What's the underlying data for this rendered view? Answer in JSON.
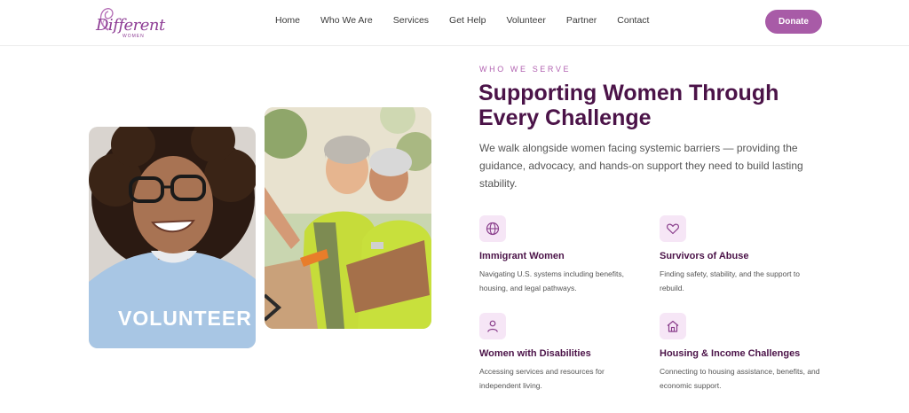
{
  "brand": {
    "logo_word": "Different",
    "logo_sub": "WOMEN"
  },
  "nav": {
    "items": [
      "Home",
      "Who We Are",
      "Services",
      "Get Help",
      "Volunteer",
      "Partner",
      "Contact"
    ],
    "donate_label": "Donate"
  },
  "photos": {
    "volunteer_shirt_text": "VOLUNTEER"
  },
  "section": {
    "eyebrow": "WHO WE SERVE",
    "title": "Supporting Women Through Every Challenge",
    "intro": "We walk alongside women facing systemic barriers — providing the guidance, advocacy, and hands-on support they need to build lasting stability."
  },
  "cards": [
    {
      "icon": "globe-icon",
      "title": "Immigrant Women",
      "desc": "Navigating U.S. systems including benefits, housing, and legal pathways."
    },
    {
      "icon": "heart-icon",
      "title": "Survivors of Abuse",
      "desc": "Finding safety, stability, and the support to rebuild."
    },
    {
      "icon": "person-icon",
      "title": "Women with Disabilities",
      "desc": "Accessing services and resources for independent living."
    },
    {
      "icon": "home-icon",
      "title": "Housing & Income Challenges",
      "desc": "Connecting to housing assistance, benefits, and economic support."
    }
  ],
  "colors": {
    "accent": "#a85ba7",
    "heading": "#4b1348",
    "icon_bg": "#f6e6f6"
  }
}
